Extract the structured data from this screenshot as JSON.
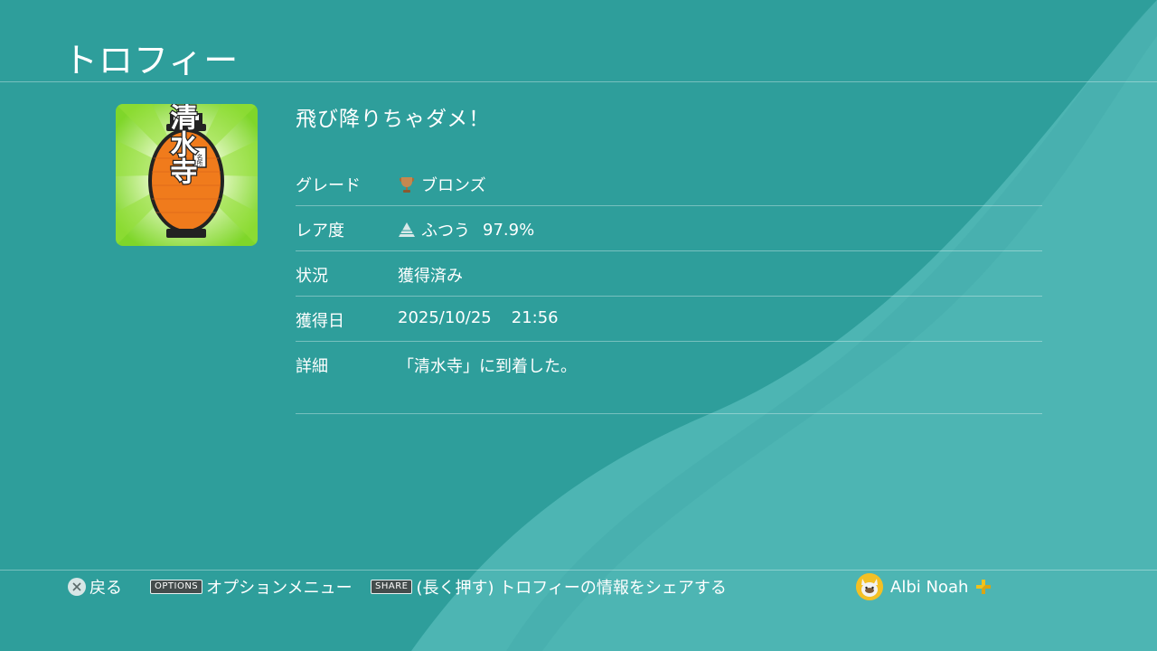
{
  "screen": {
    "title": "トロフィー"
  },
  "trophy": {
    "name": "飛び降りちゃダメ！",
    "icon": {
      "label": "清水寺",
      "sublabel": "名所",
      "background_color": "#7fd62a",
      "lantern_color": "#f07b1c"
    },
    "details": [
      {
        "key": "grade",
        "label": "グレード",
        "value": "ブロンズ",
        "icon": "bronze-trophy-icon"
      },
      {
        "key": "rarity",
        "label": "レア度",
        "value": "ふつう",
        "extra": "97.9%",
        "icon": "rarity-common-icon"
      },
      {
        "key": "status",
        "label": "状況",
        "value": "獲得済み"
      },
      {
        "key": "earned",
        "label": "獲得日",
        "value": "2025/10/25",
        "extra": "21:56"
      },
      {
        "key": "detail",
        "label": "詳細",
        "value": "「清水寺」に到着した。"
      }
    ]
  },
  "footer": {
    "back": {
      "icon": "cross-button-icon",
      "label": "戻る"
    },
    "options": {
      "badge": "OPTIONS",
      "label": "オプションメニュー"
    },
    "share": {
      "badge": "SHARE",
      "label": "(長く押す) トロフィーの情報をシェアする"
    },
    "user": {
      "name": "Albi Noah",
      "avatar_icon": "avatar",
      "plus_icon": "ps-plus-icon"
    }
  },
  "colors": {
    "background": "#2e9e9b",
    "wave_light": "#4db5b3",
    "text": "#ffffff",
    "bronze": "#c5884f"
  }
}
